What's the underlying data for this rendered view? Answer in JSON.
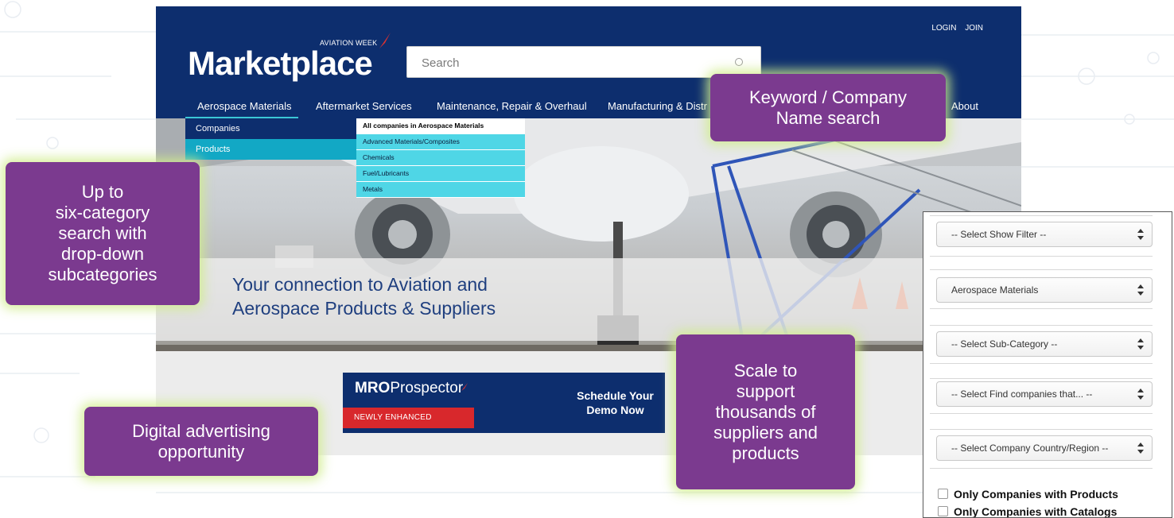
{
  "header": {
    "brand_small": "AVIATION WEEK",
    "brand_main": "Marketplace",
    "search_placeholder": "Search",
    "login": "LOGIN",
    "join": "JOIN"
  },
  "nav": {
    "items": [
      "Aerospace Materials",
      "Aftermarket Services",
      "Maintenance, Repair & Overhaul",
      "Manufacturing & Distr",
      "About"
    ]
  },
  "menu": {
    "left": [
      "Companies",
      "Products"
    ],
    "right": [
      "All companies in Aerospace Materials",
      "Advanced Materials/Composites",
      "Chemicals",
      "Fuel/Lubricants",
      "Metals"
    ]
  },
  "hero": {
    "line1": "Your connection to Aviation and",
    "line2": "Aerospace Products & Suppliers"
  },
  "ad": {
    "brand_bold": "MRO",
    "brand_rest": "Prospector",
    "badge": "NEWLY ENHANCED",
    "cta_line1": "Schedule Your",
    "cta_line2": "Demo Now"
  },
  "filters": {
    "selects": [
      "-- Select Show Filter --",
      "Aerospace Materials",
      "-- Select Sub-Category --",
      "-- Select Find companies that... --",
      "-- Select Company Country/Region --"
    ],
    "checks": [
      "Only Companies with Products",
      "Only Companies with Catalogs"
    ]
  },
  "callouts": {
    "category": [
      "Up to",
      "six-category",
      "search with",
      "drop-down",
      "subcategories"
    ],
    "keyword": [
      "Keyword / Company",
      "Name search"
    ],
    "scale": [
      "Scale to",
      "support",
      "thousands of",
      "suppliers and",
      "products"
    ],
    "ads": [
      "Digital advertising",
      "opportunity"
    ]
  },
  "colors": {
    "navy": "#0d2e6e",
    "cyan": "#12a8c5",
    "callout_purple": "#7b3a8f",
    "callout_glow": "#d0ec8c",
    "ad_red": "#d8282c"
  }
}
